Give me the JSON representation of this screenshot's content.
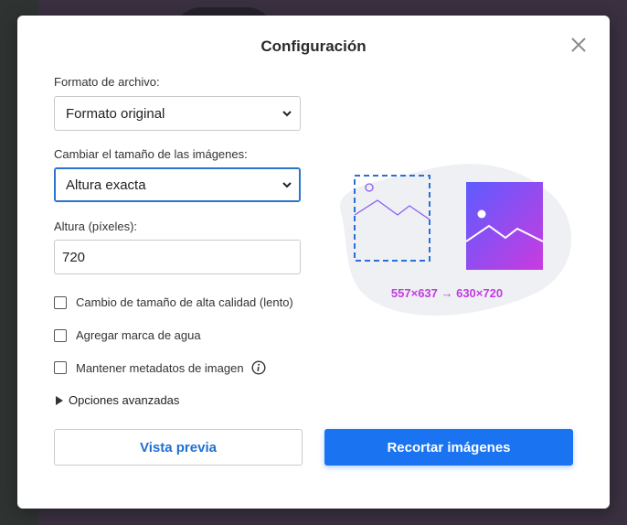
{
  "dialog": {
    "title": "Configuración"
  },
  "format": {
    "label": "Formato de archivo:",
    "value": "Formato original"
  },
  "resize": {
    "label": "Cambiar el tamaño de las imágenes:",
    "value": "Altura exacta"
  },
  "height": {
    "label": "Altura (píxeles):",
    "value": "720"
  },
  "options": {
    "high_quality": {
      "label": "Cambio de tamaño de alta calidad (lento)",
      "checked": false
    },
    "watermark": {
      "label": "Agregar marca de agua",
      "checked": false
    },
    "metadata": {
      "label": "Mantener metadatos de imagen",
      "checked": false
    }
  },
  "advanced": {
    "label": "Opciones avanzadas"
  },
  "preview": {
    "dimensions": "557×637 → 630×720"
  },
  "buttons": {
    "preview_label": "Vista previa",
    "crop_label": "Recortar imágenes"
  },
  "colors": {
    "accent": "#1a73f0",
    "link": "#1f6fd1",
    "dimension_text": "#c43ae0",
    "gradient_start": "#6b4dff",
    "gradient_end": "#c93be0"
  },
  "icons": {
    "close": "close-icon",
    "chevron": "chevron-down-icon",
    "info": "info-icon",
    "expand": "triangle-right-icon"
  }
}
